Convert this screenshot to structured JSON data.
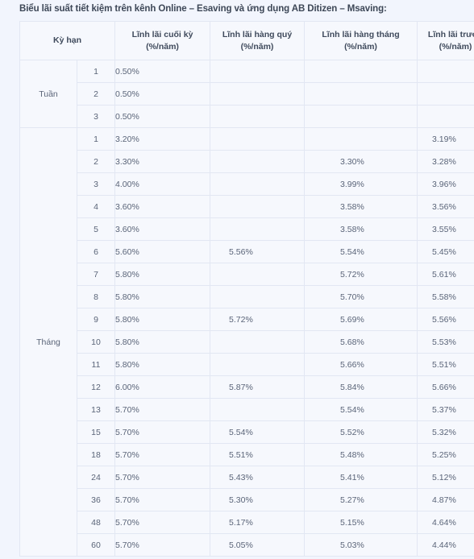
{
  "caption": "Biểu lãi suất tiết kiệm trên kênh Online – Esaving và ứng dụng AB Ditizen – Msaving:",
  "table": {
    "headers": {
      "term": "Kỳ hạn",
      "end_of_term": "Lĩnh lãi cuối kỳ",
      "quarterly": "Lĩnh lãi hàng quý",
      "monthly": "Lĩnh lãi hàng tháng",
      "upfront": "Lĩnh lãi trước",
      "unit": "(%/năm)"
    },
    "groups": [
      {
        "label": "Tuần",
        "rows": [
          {
            "term": "1",
            "end_of_term": "0.50%",
            "quarterly": "",
            "monthly": "",
            "upfront": ""
          },
          {
            "term": "2",
            "end_of_term": "0.50%",
            "quarterly": "",
            "monthly": "",
            "upfront": ""
          },
          {
            "term": "3",
            "end_of_term": "0.50%",
            "quarterly": "",
            "monthly": "",
            "upfront": ""
          }
        ]
      },
      {
        "label": "Tháng",
        "rows": [
          {
            "term": "1",
            "end_of_term": "3.20%",
            "quarterly": "",
            "monthly": "",
            "upfront": "3.19%"
          },
          {
            "term": "2",
            "end_of_term": "3.30%",
            "quarterly": "",
            "monthly": "3.30%",
            "upfront": "3.28%"
          },
          {
            "term": "3",
            "end_of_term": "4.00%",
            "quarterly": "",
            "monthly": "3.99%",
            "upfront": "3.96%"
          },
          {
            "term": "4",
            "end_of_term": "3.60%",
            "quarterly": "",
            "monthly": "3.58%",
            "upfront": "3.56%"
          },
          {
            "term": "5",
            "end_of_term": "3.60%",
            "quarterly": "",
            "monthly": "3.58%",
            "upfront": "3.55%"
          },
          {
            "term": "6",
            "end_of_term": "5.60%",
            "quarterly": "5.56%",
            "monthly": "5.54%",
            "upfront": "5.45%"
          },
          {
            "term": "7",
            "end_of_term": "5.80%",
            "quarterly": "",
            "monthly": "5.72%",
            "upfront": "5.61%"
          },
          {
            "term": "8",
            "end_of_term": "5.80%",
            "quarterly": "",
            "monthly": "5.70%",
            "upfront": "5.58%"
          },
          {
            "term": "9",
            "end_of_term": "5.80%",
            "quarterly": "5.72%",
            "monthly": "5.69%",
            "upfront": "5.56%"
          },
          {
            "term": "10",
            "end_of_term": "5.80%",
            "quarterly": "",
            "monthly": "5.68%",
            "upfront": "5.53%"
          },
          {
            "term": "11",
            "end_of_term": "5.80%",
            "quarterly": "",
            "monthly": "5.66%",
            "upfront": "5.51%"
          },
          {
            "term": "12",
            "end_of_term": "6.00%",
            "quarterly": "5.87%",
            "monthly": "5.84%",
            "upfront": "5.66%"
          },
          {
            "term": "13",
            "end_of_term": "5.70%",
            "quarterly": "",
            "monthly": "5.54%",
            "upfront": "5.37%"
          },
          {
            "term": "15",
            "end_of_term": "5.70%",
            "quarterly": "5.54%",
            "monthly": "5.52%",
            "upfront": "5.32%"
          },
          {
            "term": "18",
            "end_of_term": "5.70%",
            "quarterly": "5.51%",
            "monthly": "5.48%",
            "upfront": "5.25%"
          },
          {
            "term": "24",
            "end_of_term": "5.70%",
            "quarterly": "5.43%",
            "monthly": "5.41%",
            "upfront": "5.12%"
          },
          {
            "term": "36",
            "end_of_term": "5.70%",
            "quarterly": "5.30%",
            "monthly": "5.27%",
            "upfront": "4.87%"
          },
          {
            "term": "48",
            "end_of_term": "5.70%",
            "quarterly": "5.17%",
            "monthly": "5.15%",
            "upfront": "4.64%"
          },
          {
            "term": "60",
            "end_of_term": "5.70%",
            "quarterly": "5.05%",
            "monthly": "5.03%",
            "upfront": "4.44%"
          }
        ]
      }
    ]
  },
  "colors": {
    "page_background": "#f2f5fd",
    "cell_background": "#f6f8fd",
    "border": "#e2e7f3",
    "text": "#5a6478",
    "heading_text": "#3f4a5c"
  }
}
